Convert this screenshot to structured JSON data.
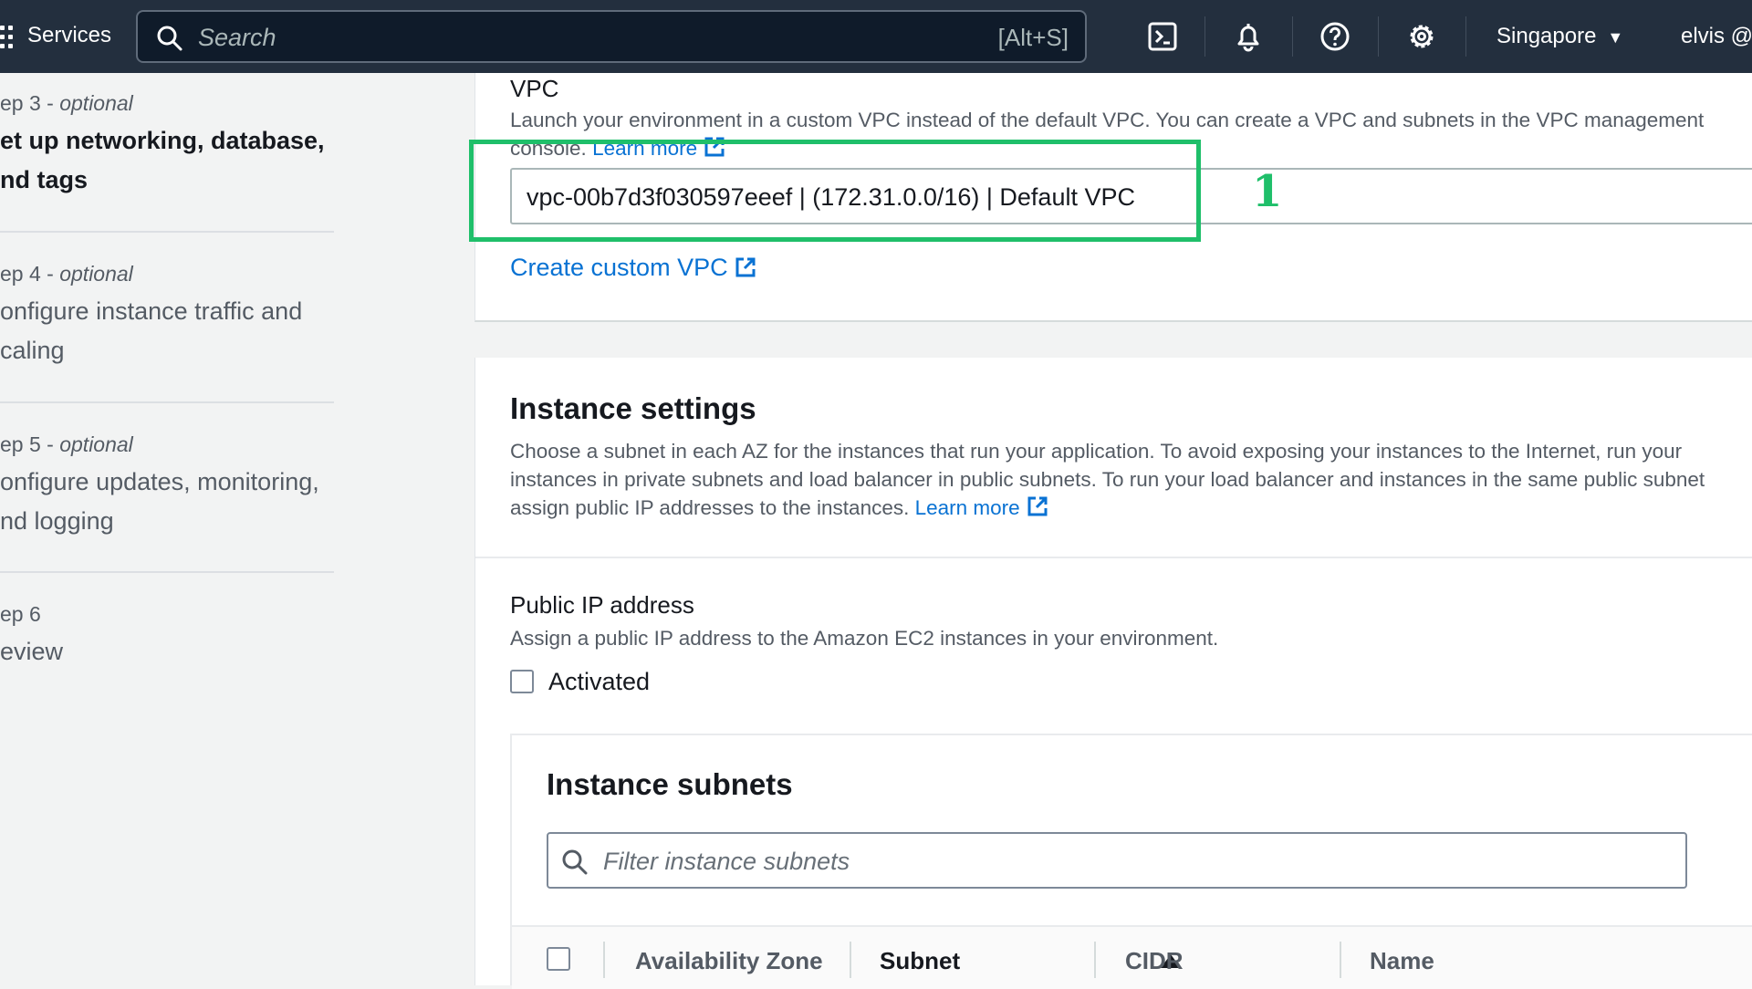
{
  "topnav": {
    "services_label": "Services",
    "search_placeholder": "Search",
    "search_shortcut": "[Alt+S]",
    "icons": [
      "cloudshell-icon",
      "bell-icon",
      "help-icon",
      "gear-icon"
    ],
    "region": "Singapore",
    "user": "elvis @"
  },
  "steps": [
    {
      "label_prefix": "ep 3 - ",
      "label_optional": "optional",
      "title_line1": "et up networking, database,",
      "title_line2": "nd tags",
      "active": true
    },
    {
      "label_prefix": "ep 4 - ",
      "label_optional": "optional",
      "title_line1": "onfigure instance traffic and",
      "title_line2": "caling",
      "active": false
    },
    {
      "label_prefix": "ep 5 - ",
      "label_optional": "optional",
      "title_line1": "onfigure updates, monitoring,",
      "title_line2": "nd logging",
      "active": false
    },
    {
      "label_prefix": "ep 6",
      "label_optional": "",
      "title_line1": "eview",
      "title_line2": "",
      "active": false
    }
  ],
  "vpc": {
    "label": "VPC",
    "description": "Launch your environment in a custom VPC instead of the default VPC. You can create a VPC and subnets in the VPC management",
    "description_line2": "console.",
    "learn_more": "Learn more",
    "selected_value": "vpc-00b7d3f030597eeef | (172.31.0.0/16) | Default VPC",
    "create_link": "Create custom VPC",
    "annotation": "1"
  },
  "instance_settings": {
    "title": "Instance settings",
    "description_line1": "Choose a subnet in each AZ for the instances that run your application. To avoid exposing your instances to the Internet, run your",
    "description_line2": "instances in private subnets and load balancer in public subnets. To run your load balancer and instances in the same public subnet",
    "description_line3": "assign public IP addresses to the instances.",
    "learn_more": "Learn more"
  },
  "public_ip": {
    "title": "Public IP address",
    "description": "Assign a public IP address to the Amazon EC2 instances in your environment.",
    "checkbox_label": "Activated",
    "checked": false
  },
  "instance_subnets": {
    "title": "Instance subnets",
    "filter_placeholder": "Filter instance subnets",
    "columns": [
      "Availability Zone",
      "Subnet",
      "CIDR",
      "Name"
    ],
    "sorted_column": "Subnet"
  },
  "colors": {
    "nav_bg": "#232f3e",
    "link": "#0972d3",
    "annotation": "#1fbf6a"
  }
}
